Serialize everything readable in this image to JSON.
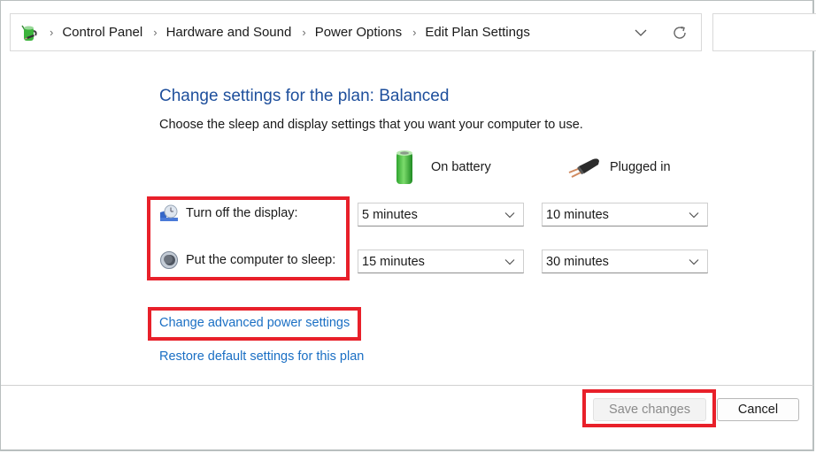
{
  "address_bar": {
    "icon": "power-options-battery-icon",
    "breadcrumbs": [
      "Control Panel",
      "Hardware and Sound",
      "Power Options",
      "Edit Plan Settings"
    ],
    "separator_icon": "chevron-right-icon",
    "dropdown_icon": "chevron-down-icon",
    "refresh_icon": "refresh-icon"
  },
  "search": {
    "value": ""
  },
  "main": {
    "title": "Change settings for the plan: Balanced",
    "subtitle": "Choose the sleep and display settings that you want your computer to use.",
    "columns": [
      {
        "label": "On battery",
        "icon": "battery-icon"
      },
      {
        "label": "Plugged in",
        "icon": "power-plug-icon"
      }
    ],
    "rows": [
      {
        "label": "Turn off the display:",
        "icon": "display-clock-icon",
        "on_battery": "5 minutes",
        "plugged_in": "10 minutes"
      },
      {
        "label": "Put the computer to sleep:",
        "icon": "sleep-moon-icon",
        "on_battery": "15 minutes",
        "plugged_in": "30 minutes"
      }
    ],
    "links": {
      "advanced": "Change advanced power settings",
      "restore": "Restore default settings for this plan"
    }
  },
  "footer": {
    "save_label": "Save changes",
    "save_enabled": false,
    "cancel_label": "Cancel"
  },
  "colors": {
    "title": "#1e4f9c",
    "link": "#1a6fc4",
    "highlight": "#e8202a"
  }
}
